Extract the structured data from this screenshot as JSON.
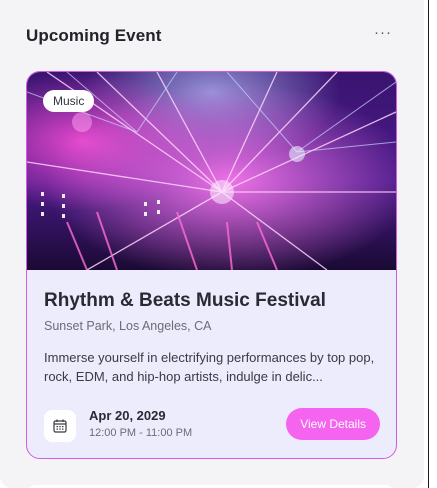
{
  "header": {
    "title": "Upcoming Event",
    "more_icon": "ellipsis-icon",
    "more_label": "···"
  },
  "event": {
    "tag": "Music",
    "title": "Rhythm & Beats Music Festival",
    "location": "Sunset Park, Los Angeles, CA",
    "description": "Immerse yourself in electrifying performances by top pop, rock, EDM, and hip-hop artists, indulge in delic...",
    "date": "Apr 20, 2029",
    "time": "12:00 PM - 11:00 PM",
    "date_icon": "calendar-icon",
    "button_label": "View Details"
  },
  "colors": {
    "accent": "#f464ee",
    "card_border": "#d35be0",
    "card_bg": "#ececfc",
    "panel_bg": "#f4f4f6"
  }
}
